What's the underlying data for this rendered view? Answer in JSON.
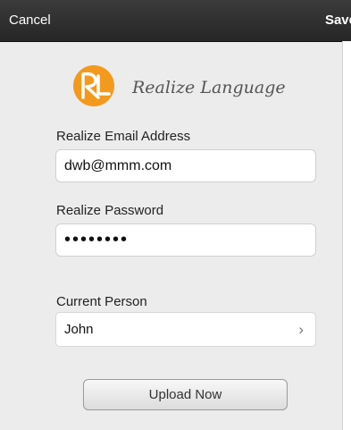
{
  "navbar": {
    "cancel_label": "Cancel",
    "save_label": "Save"
  },
  "logo": {
    "text": "Realize Language",
    "icon": "rl-logo-icon",
    "accent": "#f39a1e"
  },
  "email": {
    "label": "Realize Email Address",
    "value": "dwb@mmm.com"
  },
  "password": {
    "label": "Realize Password",
    "value": "••••••••"
  },
  "person": {
    "label": "Current Person",
    "value": "John",
    "chevron": "›"
  },
  "upload": {
    "label": "Upload Now"
  }
}
